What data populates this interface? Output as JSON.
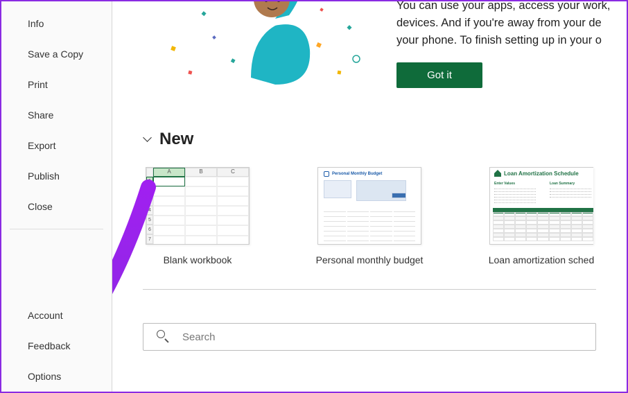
{
  "sidebar": {
    "items_top": [
      {
        "label": "Info"
      },
      {
        "label": "Save a Copy"
      },
      {
        "label": "Print"
      },
      {
        "label": "Share"
      },
      {
        "label": "Export"
      },
      {
        "label": "Publish"
      },
      {
        "label": "Close"
      }
    ],
    "items_bottom": [
      {
        "label": "Account"
      },
      {
        "label": "Feedback"
      },
      {
        "label": "Options"
      }
    ]
  },
  "banner": {
    "line1": "You can use your apps, access your work,",
    "line2": "devices. And if you're away from your de",
    "line3": "your phone. To finish setting up in your o",
    "button": "Got it"
  },
  "new_section": {
    "title": "New",
    "templates": [
      {
        "label": "Blank workbook"
      },
      {
        "label": "Personal monthly budget"
      },
      {
        "label": "Loan amortization sched"
      }
    ],
    "budget_thumb_title": "Personal Monthly Budget",
    "amort_thumb_title": "Loan Amortization Schedule",
    "amort_left_label": "Enter Values",
    "amort_right_label": "Loan Summary"
  },
  "search": {
    "placeholder": "Search"
  },
  "mini_grid": {
    "cols": [
      "A",
      "B",
      "C"
    ],
    "rows": [
      "1",
      "2",
      "3",
      "4",
      "5",
      "6",
      "7"
    ]
  }
}
